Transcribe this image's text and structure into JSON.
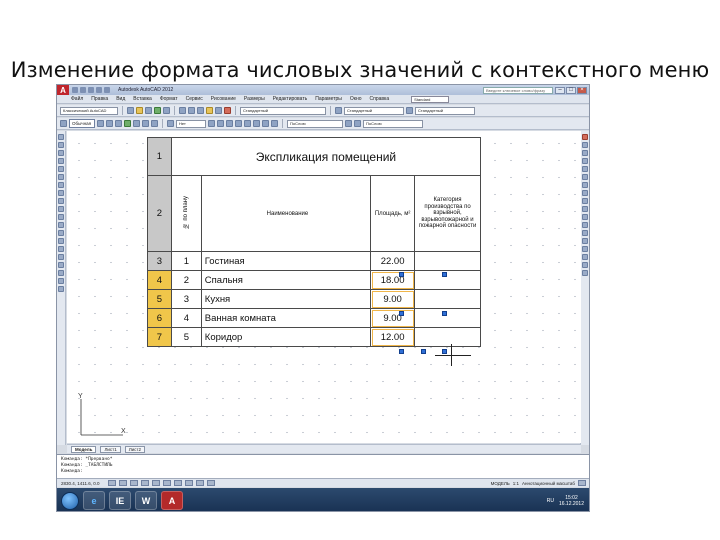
{
  "slide": {
    "title": "Изменение формата числовых значений с контекстного меню"
  },
  "app": {
    "title": "Autodesk AutoCAD 2012",
    "search_placeholder": "Введите ключевое слово/фразу",
    "menu": [
      "Файл",
      "Правка",
      "Вид",
      "Вставка",
      "Формат",
      "Сервис",
      "Рисование",
      "Размеры",
      "Редактировать",
      "Параметры",
      "Окно",
      "Справка"
    ],
    "menu_combo": "Standard",
    "workspace": "Классический AutoCAD",
    "layer": "Нет",
    "table_style": "Стандартный",
    "text_block": "Обычная",
    "props_combo": "ПоСлою"
  },
  "table": {
    "title_row_num": "1",
    "title": "Экспликация помещений",
    "head_row_num": "2",
    "headers": {
      "number": "№ по плану",
      "name": "Наименование",
      "area": "Площадь, м²",
      "category": "Категория производства по взрывной, взрывопожарной и пожарной опасности"
    },
    "rows": [
      {
        "row_num": "3",
        "num": "1",
        "name": "Гостиная",
        "area": "22.00",
        "category": ""
      },
      {
        "row_num": "4",
        "num": "2",
        "name": "Спальня",
        "area": "18.00",
        "category": ""
      },
      {
        "row_num": "5",
        "num": "3",
        "name": "Кухня",
        "area": "9.00",
        "category": ""
      },
      {
        "row_num": "6",
        "num": "4",
        "name": "Ванная комната",
        "area": "9.00",
        "category": ""
      },
      {
        "row_num": "7",
        "num": "5",
        "name": "Коридор",
        "area": "12.00",
        "category": ""
      }
    ]
  },
  "layout_tabs": [
    "Модель",
    "Лист1",
    "Лист2"
  ],
  "command_line": {
    "lines": [
      "Команда: *Прервано*",
      "Команда: _ТАБЛСТИЛЬ",
      "Команда:"
    ]
  },
  "status": {
    "coords": "2830.4, 1411.6, 0.0",
    "model_label": "МОДЕЛЬ",
    "scale": "1:1",
    "annotation": "Аннотационный масштаб"
  },
  "taskbar": {
    "apps": [
      "e",
      "IE",
      "W",
      "A"
    ],
    "lang": "RU",
    "time": "15:02",
    "date": "16.12.2012"
  }
}
